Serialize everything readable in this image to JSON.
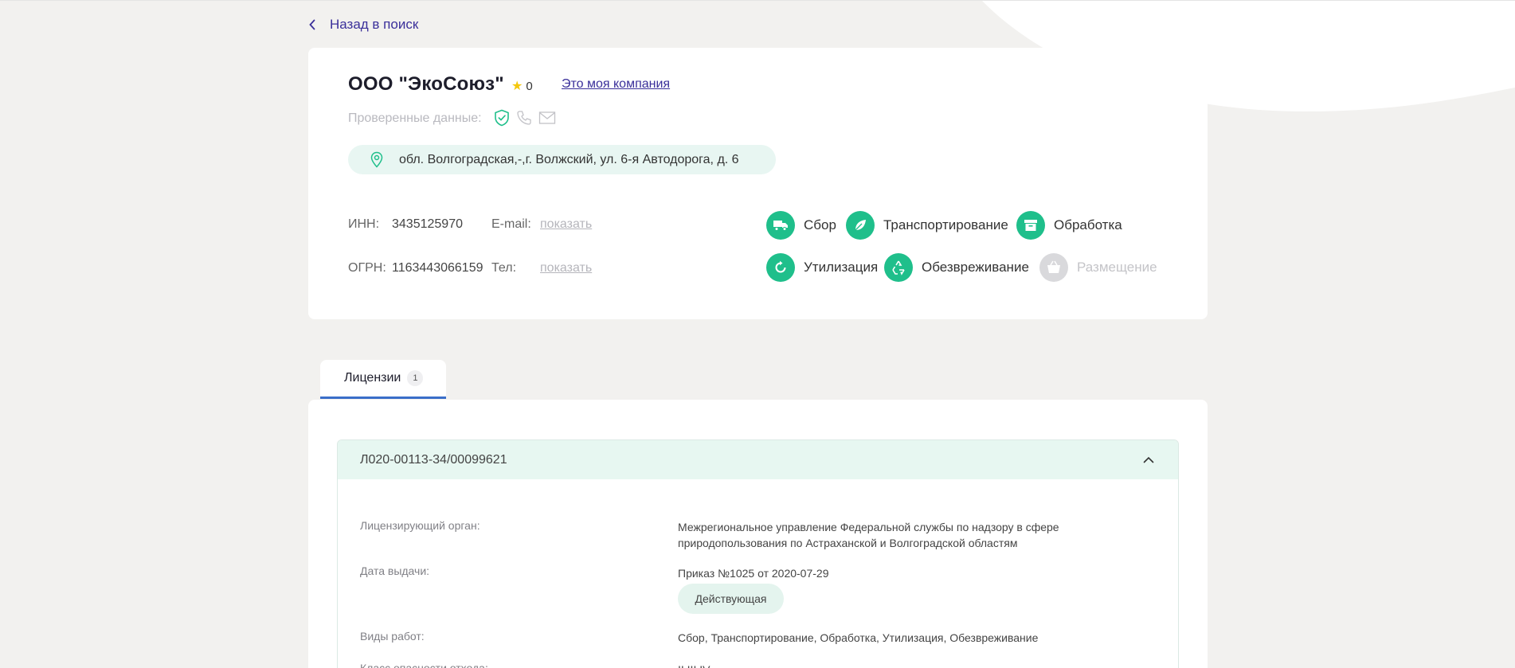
{
  "nav": {
    "back_label": "Назад в поиск"
  },
  "company": {
    "name": "ООО \"ЭкоСоюз\"",
    "rating": "0",
    "claim_link": "Это моя компания",
    "verified_label": "Проверенные данные:",
    "address": "обл. Волгоградская,-,г. Волжский, ул. 6-я Автодорога, д. 6",
    "inn_label": "ИНН:",
    "inn": "3435125970",
    "ogrn_label": "ОГРН:",
    "ogrn": "1163443066159",
    "email_label": "E-mail:",
    "email_link": "показать",
    "phone_label": "Тел:",
    "phone_link": "показать"
  },
  "activities": [
    {
      "label": "Сбор",
      "icon": "truck-icon",
      "active": true
    },
    {
      "label": "Транспортирование",
      "icon": "leaf-icon",
      "active": true
    },
    {
      "label": "Обработка",
      "icon": "archive-box-icon",
      "active": true
    },
    {
      "label": "Утилизация",
      "icon": "refresh-icon",
      "active": true
    },
    {
      "label": "Обезвреживание",
      "icon": "recycle-icon",
      "active": true
    },
    {
      "label": "Размещение",
      "icon": "basket-icon",
      "active": false
    }
  ],
  "tabs": [
    {
      "label": "Лицензии",
      "count": "1"
    }
  ],
  "license": {
    "number": "Л020-00113-34/00099621",
    "authority_label": "Лицензирующий орган:",
    "authority": "Межрегиональное управление Федеральной службы по надзору в сфере природопользования по Астраханской и Волгоградской областям",
    "date_label": "Дата выдачи:",
    "date": "Приказ №1025 от 2020-07-29",
    "status": "Действующая",
    "works_label": "Виды работ:",
    "works": "Сбор, Транспортирование, Обработка, Утилизация, Обезвреживание",
    "hazard_label": "Класс опасности отхода:",
    "hazard": "II,III,IV"
  },
  "colors": {
    "accent_green": "#1fbf8b",
    "link_purple": "#3a2f9a",
    "tab_underline": "#3a6ec9",
    "star": "#f4c70b"
  }
}
